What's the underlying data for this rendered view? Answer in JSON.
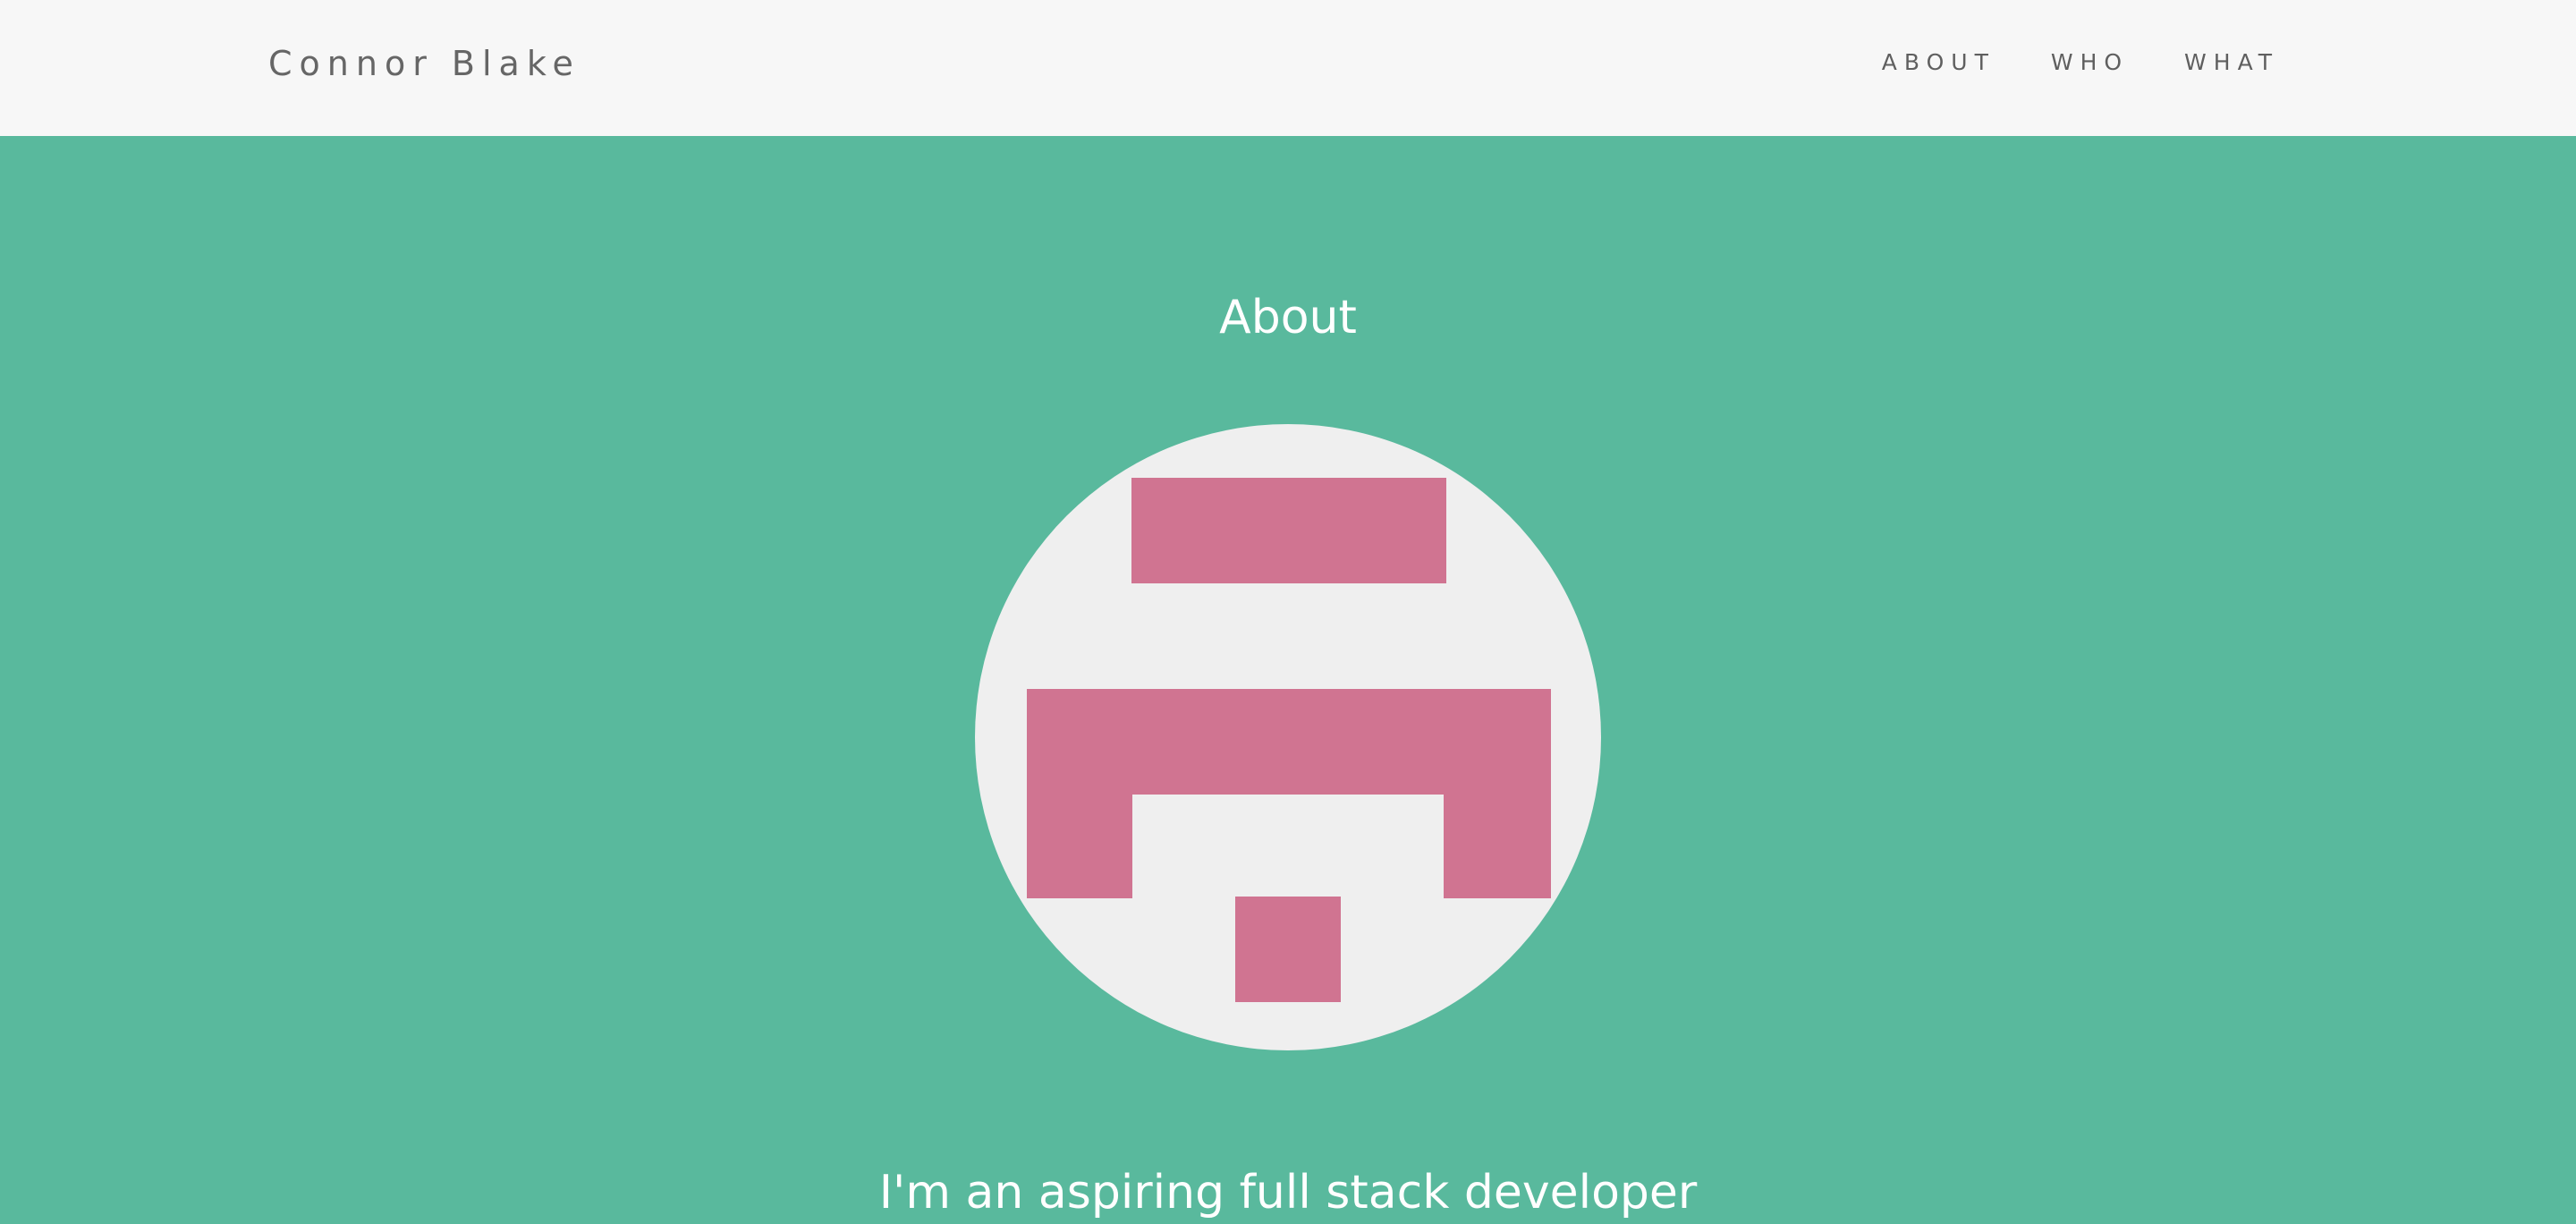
{
  "header": {
    "brand": "Connor Blake",
    "nav": [
      {
        "label": "ABOUT"
      },
      {
        "label": "WHO"
      },
      {
        "label": "WHAT"
      }
    ]
  },
  "main": {
    "title": "About",
    "tagline": "I'm an aspiring full stack developer"
  },
  "avatar": {
    "icon": "pixel-identicon",
    "background_color": "#efefef",
    "block_color": "#d07491"
  },
  "colors": {
    "accent_background": "#59b99d",
    "header_background": "#f7f7f7",
    "brand_text": "#666666"
  }
}
